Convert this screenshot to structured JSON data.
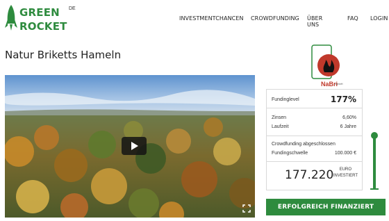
{
  "brand": {
    "name_line1": "GREEN",
    "name_line2": "ROCKET",
    "language": "DE",
    "color": "#2e8b3e"
  },
  "nav": {
    "items": [
      {
        "label": "INVESTMENTCHANCEN"
      },
      {
        "label": "CROWDFUNDING"
      },
      {
        "label": "ÜBER UNS"
      },
      {
        "label": "FAQ"
      },
      {
        "label": "LOGIN"
      }
    ]
  },
  "project": {
    "title": "Natur Briketts Hameln",
    "company_name": "NaBri",
    "company_suffix": "GmbH"
  },
  "video": {
    "play_icon": "play-icon",
    "fullscreen_icon": "fullscreen-icon"
  },
  "funding": {
    "level_label": "Fundinglevel",
    "level_value": "177%",
    "interest_label": "Zinsen",
    "interest_value": "6,60%",
    "term_label": "Laufzeit",
    "term_value": "6 Jahre",
    "status_text": "Crowdfunding abgeschlossen",
    "threshold_label": "Fundingschwelle",
    "threshold_value": "100.000 €",
    "amount": "177.220",
    "currency_line1": "EURO",
    "currency_line2": "INVESTIERT",
    "progress_fraction": 1.0
  },
  "status_button": {
    "label": "ERFOLGREICH FINANZIERT",
    "color": "#2e8b3e"
  }
}
